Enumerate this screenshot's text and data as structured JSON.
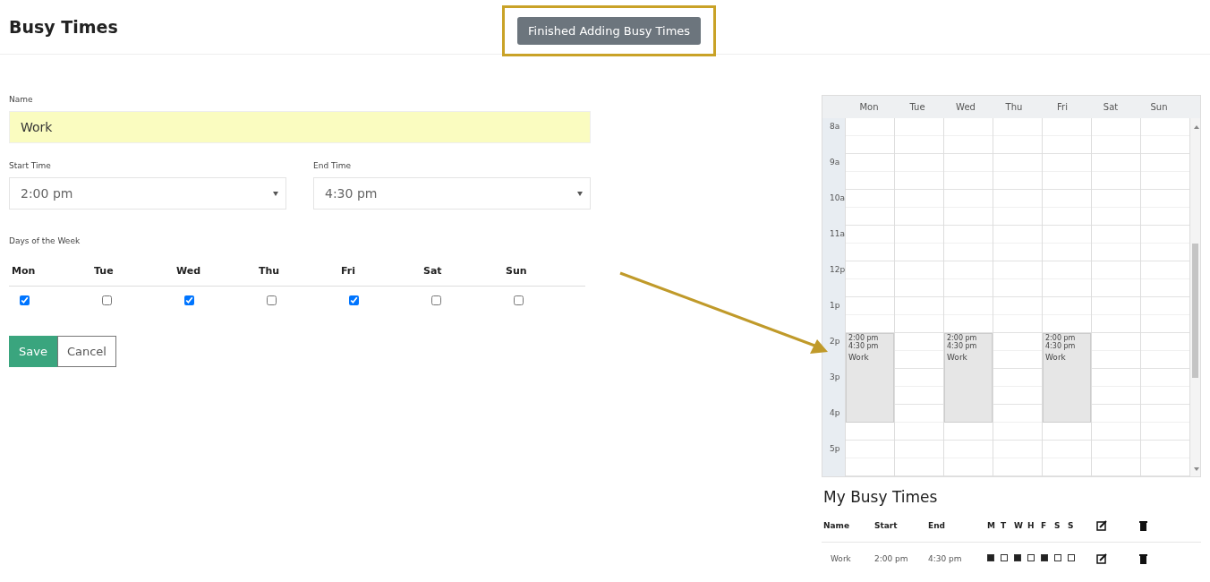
{
  "header": {
    "title": "Busy Times",
    "finish_button": "Finished Adding Busy Times"
  },
  "form": {
    "name_label": "Name",
    "name_value": "Work",
    "start_label": "Start Time",
    "start_value": "2:00 pm",
    "end_label": "End Time",
    "end_value": "4:30 pm",
    "days_label": "Days of the Week",
    "days": [
      {
        "label": "Mon",
        "checked": true
      },
      {
        "label": "Tue",
        "checked": false
      },
      {
        "label": "Wed",
        "checked": true
      },
      {
        "label": "Thu",
        "checked": false
      },
      {
        "label": "Fri",
        "checked": true
      },
      {
        "label": "Sat",
        "checked": false
      },
      {
        "label": "Sun",
        "checked": false
      }
    ],
    "save_button": "Save",
    "cancel_button": "Cancel"
  },
  "calendar": {
    "hours": [
      "8a",
      "9a",
      "10a",
      "11a",
      "12p",
      "1p",
      "2p",
      "3p",
      "4p",
      "5p"
    ],
    "days": [
      {
        "label": "Mon",
        "events": [
          {
            "start": "2:00 pm",
            "end": "4:30 pm",
            "name": "Work"
          }
        ]
      },
      {
        "label": "Tue"
      },
      {
        "label": "Wed",
        "events": [
          {
            "start": "2:00 pm",
            "end": "4:30 pm",
            "name": "Work"
          }
        ]
      },
      {
        "label": "Thu"
      },
      {
        "label": "Fri",
        "events": [
          {
            "start": "2:00 pm",
            "end": "4:30 pm",
            "name": "Work"
          }
        ]
      },
      {
        "label": "Sat"
      },
      {
        "label": "Sun"
      }
    ]
  },
  "busy_list": {
    "title": "My Busy Times",
    "columns": [
      "Name",
      "Start",
      "End",
      "M",
      "T",
      "W",
      "H",
      "F",
      "S",
      "S"
    ],
    "rows": [
      {
        "name": "Work",
        "start": "2:00 pm",
        "end": "4:30 pm",
        "days": [
          {
            "checked": true
          },
          {
            "checked": false
          },
          {
            "checked": true
          },
          {
            "checked": false
          },
          {
            "checked": true
          },
          {
            "checked": false
          },
          {
            "checked": false
          }
        ]
      }
    ]
  }
}
